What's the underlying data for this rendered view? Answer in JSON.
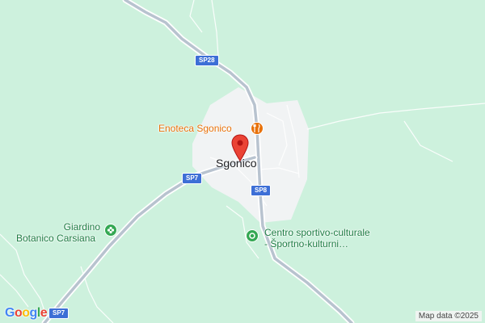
{
  "map": {
    "background_color": "#cdf1dd",
    "town": {
      "name": "Sgonico"
    },
    "road_labels": [
      "SP28",
      "SP7",
      "SP8",
      "SP7"
    ],
    "pois": [
      {
        "name": "Enoteca Sgonico",
        "category": "restaurant",
        "icon": "fork-knife-icon",
        "color": "#e8710a"
      },
      {
        "name_line1": "Giardino",
        "name_line2": "Botanico Carsiana",
        "category": "garden",
        "icon": "flower-icon",
        "color": "#34a853"
      },
      {
        "name_line1": "Centro sportivo-culturale",
        "name_line2": "- Športno-kulturni…",
        "category": "sports",
        "icon": "circle-dot-icon",
        "color": "#34a853"
      }
    ],
    "marker": {
      "icon": "location-pin-icon",
      "color": "#ea4335"
    },
    "logo": {
      "text": "Google",
      "letters": [
        "G",
        "o",
        "o",
        "g",
        "l",
        "e"
      ],
      "colors": [
        "#4285f4",
        "#ea4335",
        "#fbbc05",
        "#4285f4",
        "#34a853",
        "#ea4335"
      ]
    },
    "attribution": "Map data ©2025"
  }
}
